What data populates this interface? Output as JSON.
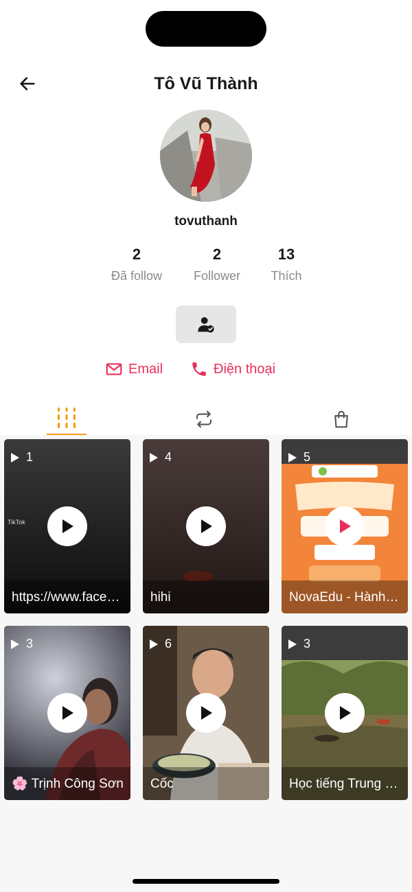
{
  "header": {
    "title": "Tô Vũ Thành",
    "back_icon": "arrow-left-icon"
  },
  "profile": {
    "username": "tovuthanh",
    "stats": [
      {
        "value": "2",
        "label": "Đã follow"
      },
      {
        "value": "2",
        "label": "Follower"
      },
      {
        "value": "13",
        "label": "Thích"
      }
    ],
    "follow_button_icon": "user-check-icon"
  },
  "contacts": {
    "email_label": "Email",
    "phone_label": "Điện thoại",
    "accent_color": "#e8305a"
  },
  "tabs": [
    {
      "icon": "grid-columns-icon",
      "active": true
    },
    {
      "icon": "repost-icon",
      "active": false
    },
    {
      "icon": "shopping-bag-icon",
      "active": false
    }
  ],
  "tab_accent_color": "#f39c12",
  "videos": [
    {
      "count": "1",
      "caption": "https://www.facebook.com/..."
    },
    {
      "count": "4",
      "caption": "hihi"
    },
    {
      "count": "5",
      "caption": "NovaEdu - Hành trình giúp"
    },
    {
      "count": "3",
      "caption": "🌸 Trịnh Công Sơn"
    },
    {
      "count": "6",
      "caption": "Cốc"
    },
    {
      "count": "3",
      "caption": "Học tiếng Trung Quốc"
    }
  ]
}
